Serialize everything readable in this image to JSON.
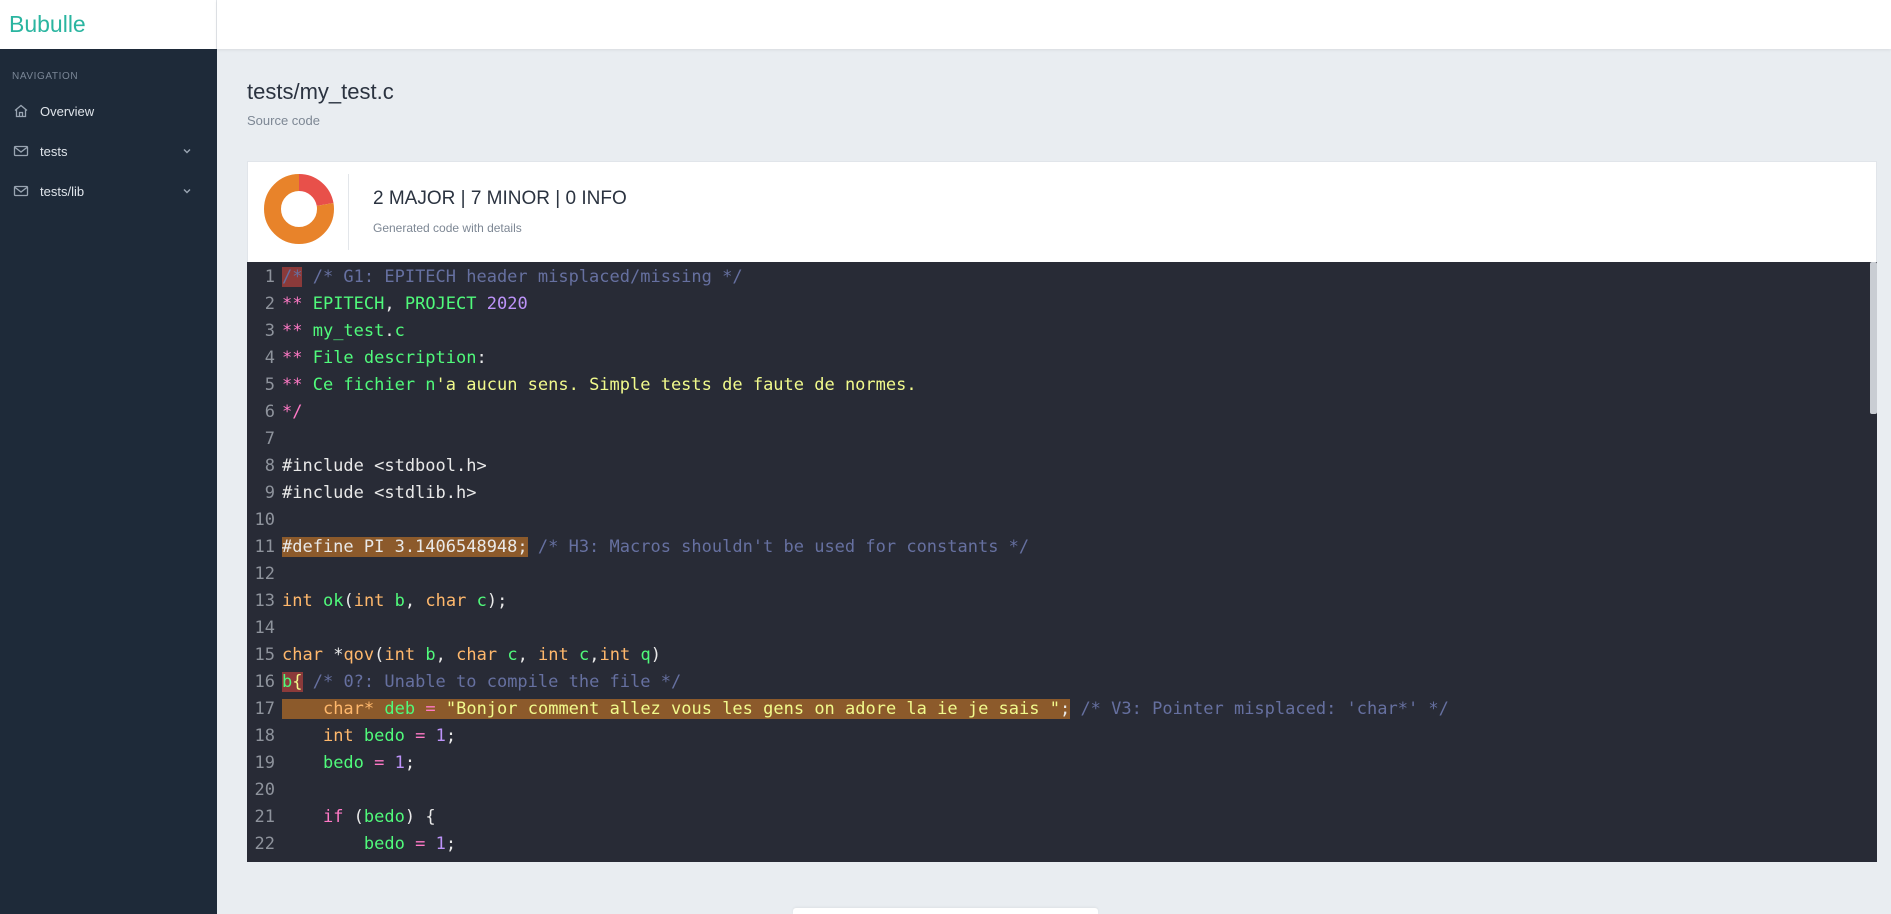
{
  "app": {
    "brand": "Bubulle"
  },
  "sidebar": {
    "heading": "NAVIGATION",
    "items": [
      {
        "label": "Overview",
        "icon": "home-icon",
        "expandable": false
      },
      {
        "label": "tests",
        "icon": "inbox-icon",
        "expandable": true
      },
      {
        "label": "tests/lib",
        "icon": "inbox-icon",
        "expandable": true
      }
    ]
  },
  "page": {
    "title": "tests/my_test.c",
    "subtitle": "Source code"
  },
  "summary": {
    "text": "2 MAJOR | 7 MINOR | 0 INFO",
    "subtext": "Generated code with details",
    "major": 2,
    "minor": 7,
    "info": 0,
    "colors": {
      "major": "#e8504a",
      "minor": "#e8832a"
    }
  },
  "code": {
    "lines": [
      [
        {
          "t": "/*",
          "c": "c-com c-hl-red"
        },
        {
          "t": " /* G1: EPITECH header misplaced/missing */",
          "c": "c-com"
        }
      ],
      [
        {
          "t": "** ",
          "c": "c-kw"
        },
        {
          "t": "EPITECH",
          "c": "c-fn"
        },
        {
          "t": ", ",
          "c": ""
        },
        {
          "t": "PROJECT",
          "c": "c-fn"
        },
        {
          "t": " ",
          "c": ""
        },
        {
          "t": "2020",
          "c": "c-num"
        }
      ],
      [
        {
          "t": "** ",
          "c": "c-kw"
        },
        {
          "t": "my_test",
          "c": "c-fn"
        },
        {
          "t": ".",
          "c": ""
        },
        {
          "t": "c",
          "c": "c-fn"
        }
      ],
      [
        {
          "t": "** ",
          "c": "c-kw"
        },
        {
          "t": "File description",
          "c": "c-fn"
        },
        {
          "t": ":",
          "c": ""
        }
      ],
      [
        {
          "t": "** ",
          "c": "c-kw"
        },
        {
          "t": "Ce fichier n",
          "c": "c-fn"
        },
        {
          "t": "'a aucun sens. Simple tests de faute de normes.",
          "c": "c-str"
        }
      ],
      [
        {
          "t": "*/",
          "c": "c-kw"
        }
      ],
      [],
      [
        {
          "t": "#include <stdbool.h>",
          "c": ""
        }
      ],
      [
        {
          "t": "#include <stdlib.h>",
          "c": ""
        }
      ],
      [],
      [
        {
          "t": "#define PI 3.1406548948;",
          "c": "c-hl-org"
        },
        {
          "t": " /* H3: Macros shouldn't be used for constants */",
          "c": "c-com"
        }
      ],
      [],
      [
        {
          "t": "int",
          "c": "c-type"
        },
        {
          "t": " ",
          "c": ""
        },
        {
          "t": "ok",
          "c": "c-fn"
        },
        {
          "t": "(",
          "c": ""
        },
        {
          "t": "int",
          "c": "c-type"
        },
        {
          "t": " ",
          "c": ""
        },
        {
          "t": "b",
          "c": "c-fn"
        },
        {
          "t": ", ",
          "c": ""
        },
        {
          "t": "char",
          "c": "c-type"
        },
        {
          "t": " ",
          "c": ""
        },
        {
          "t": "c",
          "c": "c-fn"
        },
        {
          "t": ");",
          "c": ""
        }
      ],
      [],
      [
        {
          "t": "char",
          "c": "c-type"
        },
        {
          "t": " *",
          "c": ""
        },
        {
          "t": "qov",
          "c": "c-type"
        },
        {
          "t": "(",
          "c": ""
        },
        {
          "t": "int",
          "c": "c-type"
        },
        {
          "t": " ",
          "c": ""
        },
        {
          "t": "b",
          "c": "c-fn"
        },
        {
          "t": ", ",
          "c": ""
        },
        {
          "t": "char",
          "c": "c-type"
        },
        {
          "t": " ",
          "c": ""
        },
        {
          "t": "c",
          "c": "c-fn"
        },
        {
          "t": ", ",
          "c": ""
        },
        {
          "t": "int",
          "c": "c-type"
        },
        {
          "t": " ",
          "c": ""
        },
        {
          "t": "c",
          "c": "c-fn"
        },
        {
          "t": ",",
          "c": ""
        },
        {
          "t": "int",
          "c": "c-type"
        },
        {
          "t": " ",
          "c": ""
        },
        {
          "t": "q",
          "c": "c-fn"
        },
        {
          "t": ")",
          "c": ""
        }
      ],
      [
        {
          "t": "b",
          "c": "c-fn c-hl-red"
        },
        {
          "t": "{",
          "c": "c-str c-hl-red"
        },
        {
          "t": " /* 0?: Unable to compile the file */",
          "c": "c-com"
        }
      ],
      [
        {
          "t": "    ",
          "c": "c-hl-org"
        },
        {
          "t": "char*",
          "c": "c-type c-hl-org"
        },
        {
          "t": " ",
          "c": "c-hl-org"
        },
        {
          "t": "deb",
          "c": "c-fn c-hl-org"
        },
        {
          "t": " ",
          "c": "c-hl-org"
        },
        {
          "t": "=",
          "c": "c-kw c-hl-org"
        },
        {
          "t": " ",
          "c": "c-hl-org"
        },
        {
          "t": "\"Bonjor comment allez vous les gens on adore la ie je sais \"",
          "c": "c-str c-hl-org"
        },
        {
          "t": ";",
          "c": "c-hl-org"
        },
        {
          "t": " /* V3: Pointer misplaced: 'char*' */",
          "c": "c-com"
        }
      ],
      [
        {
          "t": "    ",
          "c": ""
        },
        {
          "t": "int",
          "c": "c-type"
        },
        {
          "t": " ",
          "c": ""
        },
        {
          "t": "bedo",
          "c": "c-fn"
        },
        {
          "t": " ",
          "c": ""
        },
        {
          "t": "=",
          "c": "c-kw"
        },
        {
          "t": " ",
          "c": ""
        },
        {
          "t": "1",
          "c": "c-num"
        },
        {
          "t": ";",
          "c": ""
        }
      ],
      [
        {
          "t": "    ",
          "c": ""
        },
        {
          "t": "bedo",
          "c": "c-fn"
        },
        {
          "t": " ",
          "c": ""
        },
        {
          "t": "=",
          "c": "c-kw"
        },
        {
          "t": " ",
          "c": ""
        },
        {
          "t": "1",
          "c": "c-num"
        },
        {
          "t": ";",
          "c": ""
        }
      ],
      [],
      [
        {
          "t": "    ",
          "c": ""
        },
        {
          "t": "if",
          "c": "c-kw"
        },
        {
          "t": " (",
          "c": ""
        },
        {
          "t": "bedo",
          "c": "c-fn"
        },
        {
          "t": ") {",
          "c": ""
        }
      ],
      [
        {
          "t": "        ",
          "c": ""
        },
        {
          "t": "bedo",
          "c": "c-fn"
        },
        {
          "t": " ",
          "c": ""
        },
        {
          "t": "=",
          "c": "c-kw"
        },
        {
          "t": " ",
          "c": ""
        },
        {
          "t": "1",
          "c": "c-num"
        },
        {
          "t": ";",
          "c": ""
        }
      ]
    ]
  }
}
